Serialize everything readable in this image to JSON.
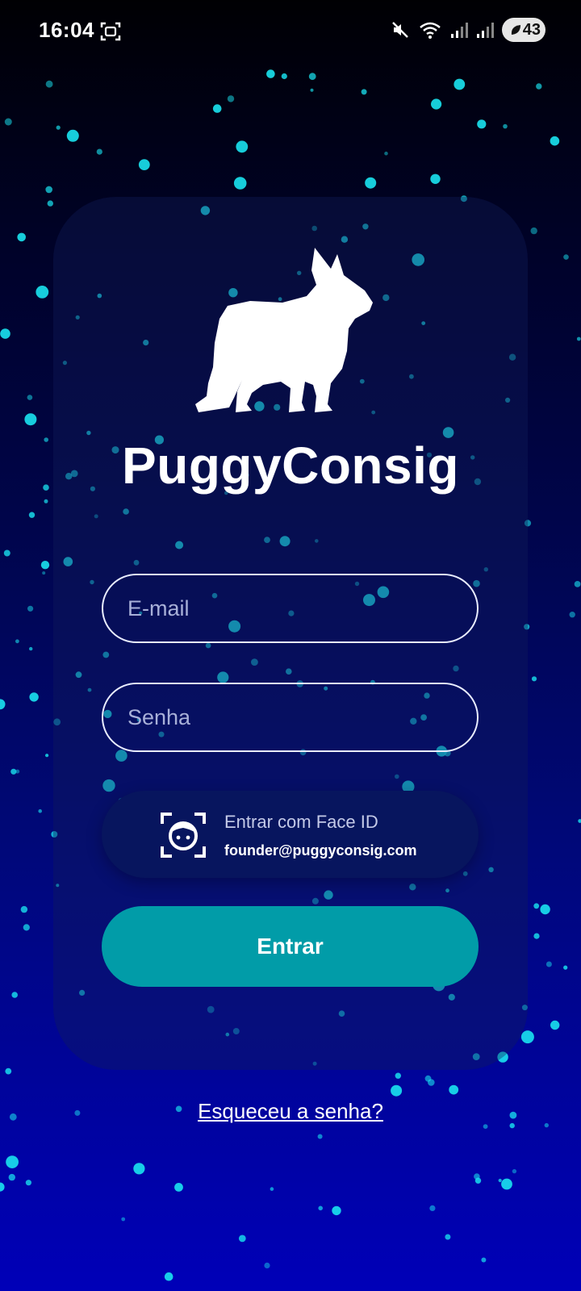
{
  "status_bar": {
    "time": "16:04",
    "battery": "43",
    "icons": [
      "screenshot-icon",
      "mute-icon",
      "wifi-icon",
      "signal-icon",
      "signal-icon",
      "leaf-icon"
    ]
  },
  "login": {
    "app_name": "PuggyConsig",
    "logo_icon": "french-bulldog-silhouette",
    "email_placeholder": "E-mail",
    "email_value": "",
    "password_placeholder": "Senha",
    "password_value": "",
    "faceid": {
      "icon": "face-id-icon",
      "label": "Entrar com Face ID",
      "email": "founder@puggyconsig.com"
    },
    "submit_label": "Entrar",
    "forgot_link": "Esqueceu a senha?"
  },
  "colors": {
    "accent": "#019ca8",
    "star": "#19e3f0",
    "background_top": "#000003",
    "background_bottom": "#0000b8"
  }
}
